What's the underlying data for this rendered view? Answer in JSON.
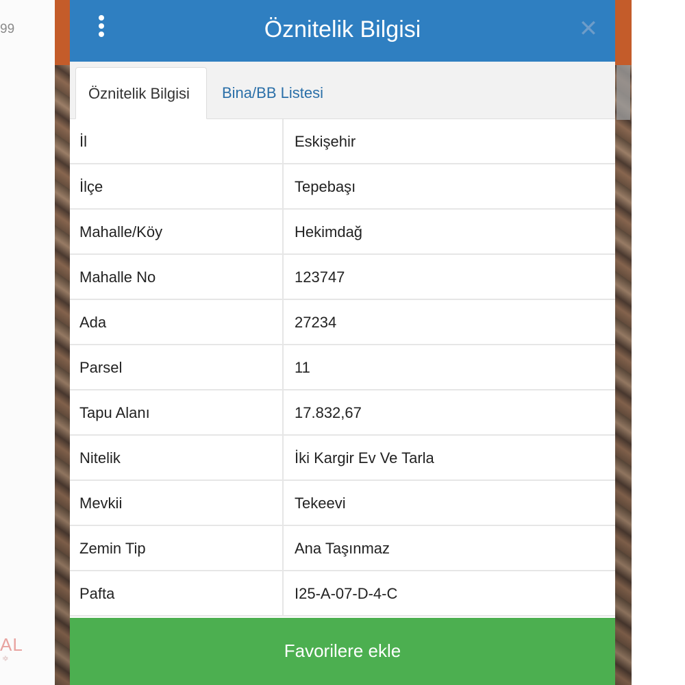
{
  "background": {
    "left_number": "99",
    "left_logo": "AL",
    "left_logo_sub": "ığı"
  },
  "modal": {
    "title": "Öznitelik Bilgisi",
    "menu_icon": "kebab-menu-icon",
    "close_icon": "close-icon",
    "header_color": "#2f7fc1",
    "tabs": [
      {
        "label": "Öznitelik Bilgisi",
        "active": true
      },
      {
        "label": "Bina/BB Listesi",
        "active": false
      }
    ],
    "rows": [
      {
        "label": "İl",
        "value": "Eskişehir"
      },
      {
        "label": "İlçe",
        "value": "Tepebaşı"
      },
      {
        "label": "Mahalle/Köy",
        "value": "Hekimdağ"
      },
      {
        "label": "Mahalle No",
        "value": "123747"
      },
      {
        "label": "Ada",
        "value": "27234"
      },
      {
        "label": "Parsel",
        "value": "11"
      },
      {
        "label": "Tapu Alanı",
        "value": "17.832,67"
      },
      {
        "label": "Nitelik",
        "value": "İki Kargir Ev Ve Tarla"
      },
      {
        "label": "Mevkii",
        "value": "Tekeevi"
      },
      {
        "label": "Zemin Tip",
        "value": "Ana Taşınmaz"
      },
      {
        "label": "Pafta",
        "value": "I25-A-07-D-4-C"
      }
    ],
    "favorite_button": "Favorilere ekle",
    "favorite_color": "#4caf50"
  }
}
